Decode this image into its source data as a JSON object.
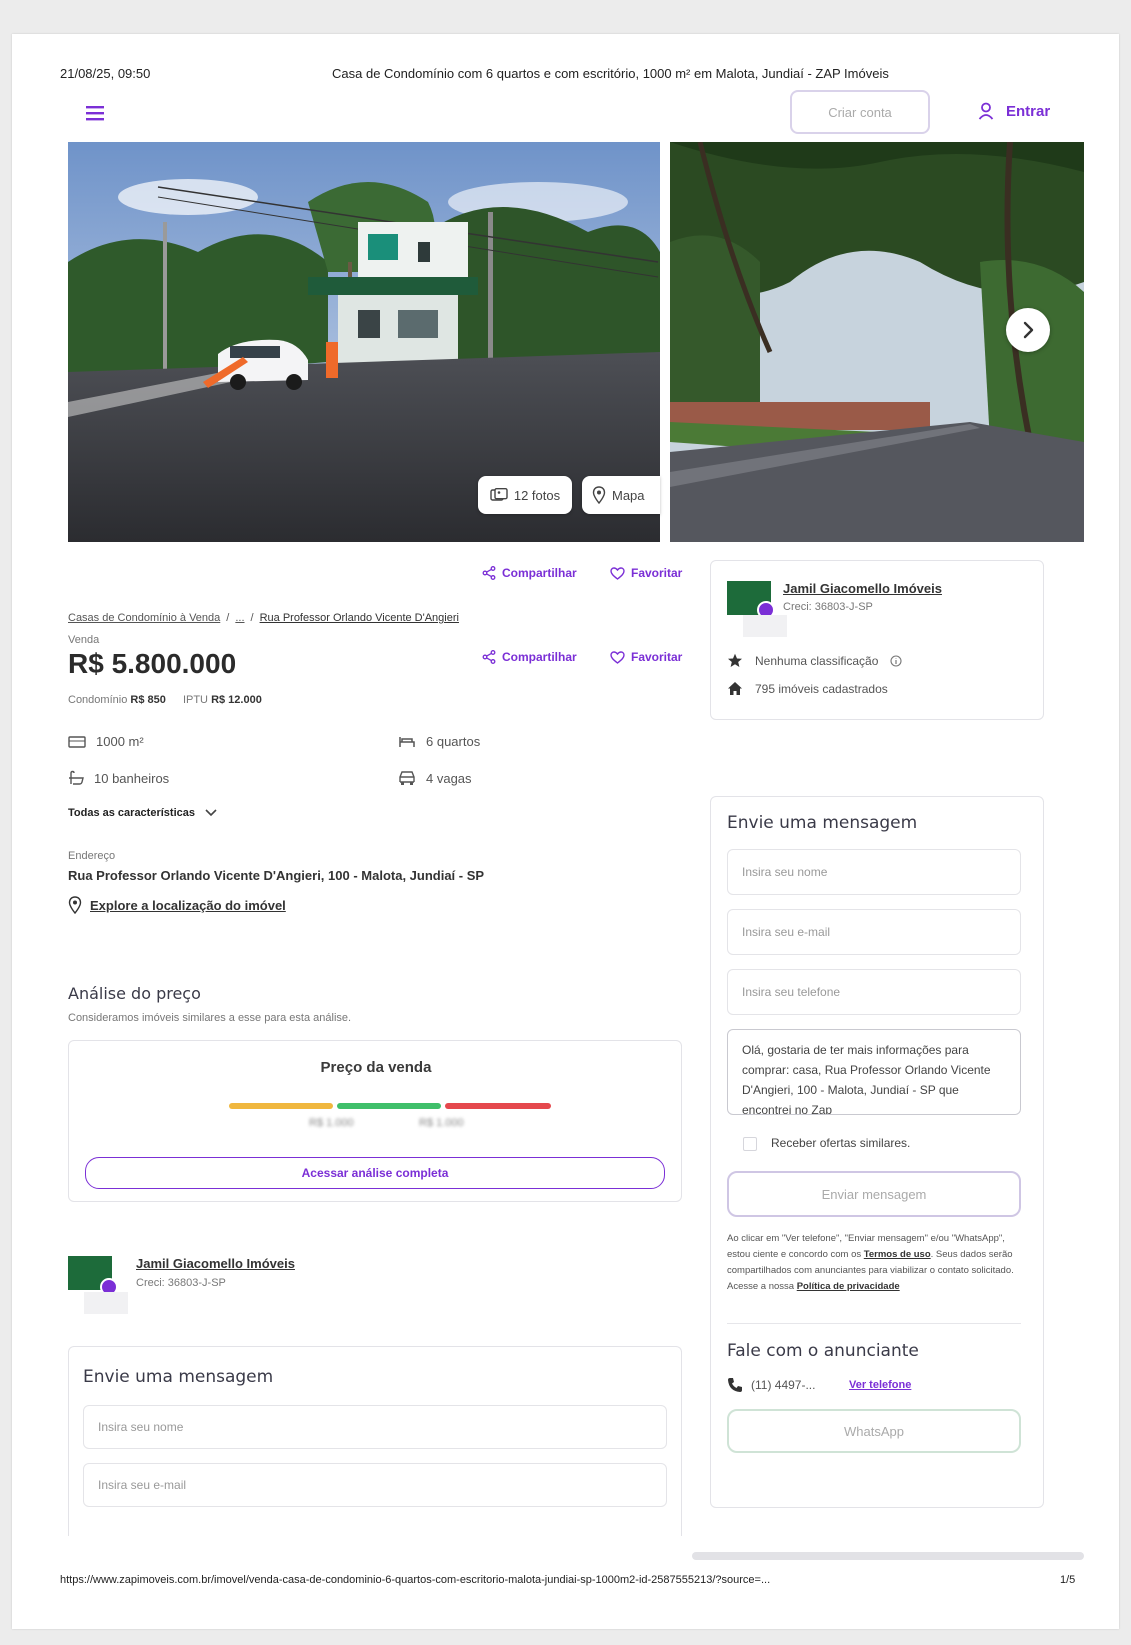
{
  "print_header": {
    "datetime": "21/08/25, 09:50",
    "title": "Casa de Condomínio com 6 quartos e com escritório, 1000 m² em Malota, Jundiaí - ZAP Imóveis"
  },
  "topbar": {
    "menu_icon": "hamburger-icon",
    "advertise_label": "Criar conta",
    "login_label": "Entrar"
  },
  "gallery": {
    "photos_label": "12 fotos",
    "map_label": "Mapa",
    "next_icon": "chevron-right-icon"
  },
  "actions": {
    "share_label": "Compartilhar",
    "favorite_label": "Favoritar"
  },
  "breadcrumb": {
    "items": [
      "Casas de Condomínio à Venda",
      "...",
      "Rua Professor Orlando Vicente D'Angieri"
    ],
    "separator": "/"
  },
  "listing": {
    "type_label": "Venda",
    "price": "R$ 5.800.000",
    "condo_label": "Condomínio",
    "condo_value": "R$ 850",
    "iptu_label": "IPTU",
    "iptu_value": "R$ 12.000",
    "features": {
      "area": "1000 m²",
      "bedrooms": "6 quartos",
      "bathrooms": "10 banheiros",
      "parking": "4 vagas"
    },
    "all_features_label": "Todas as características",
    "address_label": "Endereço",
    "address": "Rua Professor Orlando Vicente D'Angieri, 100 - Malota, Jundiaí - SP",
    "explore_label": "Explore a localização do imóvel"
  },
  "price_analysis": {
    "heading": "Análise do preço",
    "subtitle": "Consideramos imóveis similares a esse para esta análise.",
    "card_title": "Preço da venda",
    "low_value": "R$ 1.000",
    "high_value": "R$ 1.000",
    "cta_label": "Acessar análise completa",
    "colors": {
      "low": "#f0b73e",
      "mid": "#3fbf6a",
      "high": "#e5484d"
    }
  },
  "advertiser": {
    "name": "Jamil Giacomello Imóveis",
    "creci": "Creci: 36803-J-SP",
    "rating_label": "Nenhuma classificação",
    "listings_label": "795 imóveis cadastrados"
  },
  "message_form": {
    "heading": "Envie uma mensagem",
    "name_placeholder": "Insira seu nome",
    "email_placeholder": "Insira seu e-mail",
    "phone_placeholder": "Insira seu telefone",
    "message_text": "Olá, gostaria de ter mais informações para comprar: casa, Rua Professor Orlando Vicente D'Angieri, 100 - Malota, Jundiaí - SP que encontrei no Zap",
    "similar_offers_label": "Receber ofertas similares.",
    "send_label": "Enviar mensagem",
    "legal_part1": "Ao clicar em \"Ver telefone\", \"Enviar mensagem\" e/ou \"WhatsApp\", estou ciente e concordo com os",
    "terms_label": "Termos de uso",
    "legal_part2": ". Seus dados serão compartilhados com anunciantes para viabilizar o contato solicitado. Acesse a nossa",
    "privacy_label": "Política de privacidade"
  },
  "contact": {
    "heading": "Fale com o anunciante",
    "phone": "(11) 4497-...",
    "show_phone_label": "Ver telefone",
    "whatsapp_label": "WhatsApp"
  },
  "lower_form": {
    "heading": "Envie uma mensagem",
    "name_placeholder": "Insira seu nome",
    "email_placeholder": "Insira seu e-mail"
  },
  "print_footer": {
    "url": "https://www.zapimoveis.com.br/imovel/venda-casa-de-condominio-6-quartos-com-escritorio-malota-jundiai-sp-1000m2-id-2587555213/?source=...",
    "page": "1/5"
  },
  "colors": {
    "accent": "#7b2fd6",
    "logo_green": "#1d6b3a"
  }
}
